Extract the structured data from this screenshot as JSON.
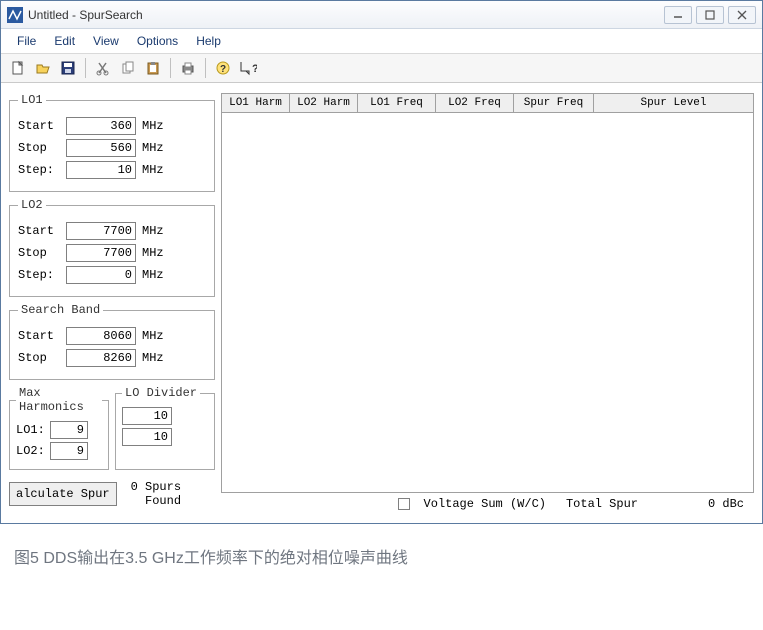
{
  "window": {
    "title": "Untitled - SpurSearch"
  },
  "menu": {
    "file": "File",
    "edit": "Edit",
    "view": "View",
    "options": "Options",
    "help": "Help"
  },
  "lo1": {
    "legend": "LO1",
    "start_lbl": "Start",
    "start_val": "360",
    "start_unit": "MHz",
    "stop_lbl": "Stop",
    "stop_val": "560",
    "stop_unit": "MHz",
    "step_lbl": "Step:",
    "step_val": "10",
    "step_unit": "MHz"
  },
  "lo2": {
    "legend": "LO2",
    "start_lbl": "Start",
    "start_val": "7700",
    "start_unit": "MHz",
    "stop_lbl": "Stop",
    "stop_val": "7700",
    "stop_unit": "MHz",
    "step_lbl": "Step:",
    "step_val": "0",
    "step_unit": "MHz"
  },
  "band": {
    "legend": "Search Band",
    "start_lbl": "Start",
    "start_val": "8060",
    "start_unit": "MHz",
    "stop_lbl": "Stop",
    "stop_val": "8260",
    "stop_unit": "MHz"
  },
  "maxharm": {
    "legend": "Max Harmonics",
    "lo1_lbl": "LO1:",
    "lo1_val": "9",
    "lo2_lbl": "LO2:",
    "lo2_val": "9"
  },
  "lodiv": {
    "legend": "LO Divider",
    "v1": "10",
    "v2": "10"
  },
  "calc": {
    "btn": "alculate Spur",
    "found": "0 Spurs\nFound"
  },
  "columns": [
    "LO1 Harm",
    "LO2 Harm",
    "LO1 Freq",
    "LO2 Freq",
    "Spur Freq",
    "Spur Level"
  ],
  "status": {
    "voltage": "Voltage Sum (W/C)",
    "total_lbl": "Total Spur",
    "total_val": "0 dBc"
  },
  "caption": "图5 DDS输出在3.5 GHz工作频率下的绝对相位噪声曲线"
}
